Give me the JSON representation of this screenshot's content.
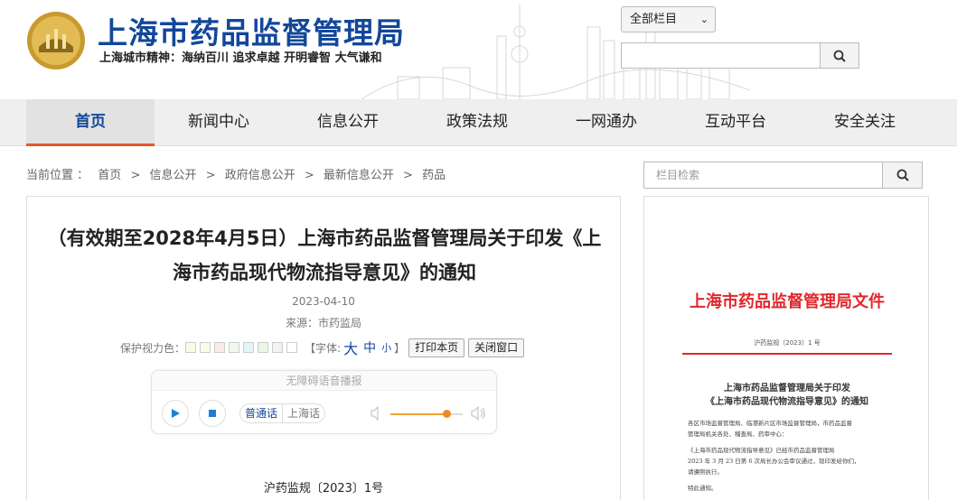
{
  "header": {
    "site_title": "上海市药品监督管理局",
    "motto": "上海城市精神：海纳百川  追求卓越  开明睿智  大气谦和",
    "scope_select": "全部栏目",
    "search_placeholder": ""
  },
  "nav": {
    "items": [
      {
        "label": "首页",
        "active": true
      },
      {
        "label": "新闻中心"
      },
      {
        "label": "信息公开"
      },
      {
        "label": "政策法规"
      },
      {
        "label": "一网通办"
      },
      {
        "label": "互动平台"
      },
      {
        "label": "安全关注"
      }
    ]
  },
  "breadcrumb": {
    "prefix": "当前位置 ：",
    "items": [
      "首页",
      "信息公开",
      "政府信息公开",
      "最新信息公开",
      "药品"
    ],
    "separator": ">"
  },
  "article": {
    "title": "（有效期至2028年4月5日）上海市药品监督管理局关于印发《上海市药品现代物流指导意见》的通知",
    "date": "2023-04-10",
    "source": "来源：市药监局",
    "protect_label": "保护视力色：",
    "swatch_colors": [
      "#fafae8",
      "#f6fde6",
      "#fde8e8",
      "#f1f9ee",
      "#e3f4fb",
      "#ecf6e7",
      "#f2f2f2",
      "#ffffff"
    ],
    "font_label": "【字体:",
    "font_large": "大",
    "font_medium": "中",
    "font_small": "小",
    "font_close": "】",
    "print_button": "打印本页",
    "close_button": "关闭窗口",
    "doc_number": "沪药监规〔2023〕1号"
  },
  "player": {
    "title": "无障碍语音播报",
    "lang_mandarin": "普通话",
    "lang_shanghai": "上海话",
    "volume": 0.78
  },
  "sidebar": {
    "search_placeholder": "栏目检索",
    "doc_preview": {
      "header": "上海市药品监督管理局文件",
      "number": "沪药监规〔2023〕1 号",
      "title_1": "上海市药品监督管理局关于印发",
      "title_2": "《上海市药品现代物流指导意见》的通知",
      "lines": [
        "各区市场监督管理局、临港新片区市场监督管理局，市药品监督",
        "管理局机关各处、稽查局、药审中心：",
        "    《上海市药品现代物流指导意见》已经市药品监督管理局",
        "2023 年 3 月 23 日第 6 次局长办公会审议通过，现印发给你们，",
        "请遵照执行。",
        "    特此通知。"
      ]
    }
  },
  "colors": {
    "brand_blue": "#12479a",
    "nav_active_underline": "#e05a2b",
    "doc_red": "#e0282c"
  }
}
